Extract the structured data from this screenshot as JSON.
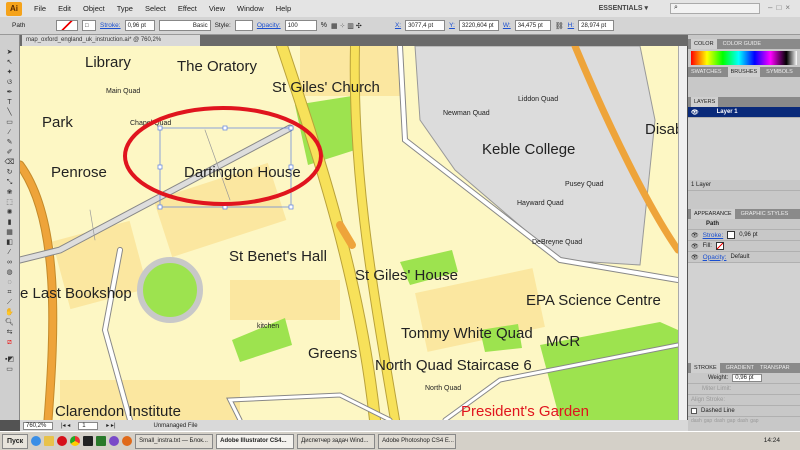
{
  "app": {
    "logo": "Ai",
    "menus": [
      "File",
      "Edit",
      "Object",
      "Type",
      "Select",
      "Effect",
      "View",
      "Window",
      "Help"
    ],
    "workspace": "ESSENTIALS ▾"
  },
  "control": {
    "selection": "Path",
    "stroke_label": "Stroke:",
    "stroke_value": "0,96 pt",
    "brush": "Basic",
    "style_label": "Style:",
    "opacity_label": "Opacity:",
    "opacity_value": "100",
    "opacity_unit": "%",
    "x_label": "X:",
    "x_value": "3077,4 pt",
    "y_label": "Y:",
    "y_value": "3220,604 pt",
    "w_label": "W:",
    "w_value": "34,475 pt",
    "h_label": "H:",
    "h_value": "28,974 pt"
  },
  "document": {
    "tab": "map_oxford_england_uk_instruction.ai* @ 760,2% (RGB/Preview)",
    "zoom": "760,2%",
    "page": "1",
    "status": "Unmanaged File"
  },
  "map": {
    "labels_large": [
      "Library",
      "The Oratory",
      "St Giles' Church",
      "Park",
      "Dartington House",
      "Penrose",
      "Keble College",
      "Disab",
      "St Benet's Hall",
      "St Giles' House",
      "e Last Bookshop",
      "EPA Science Centre",
      "Tommy White Quad",
      "MCR",
      "Greens",
      "North Quad Staircase 6",
      "Clarendon Institute"
    ],
    "labels_small": [
      "Main Quad",
      "Chapel Quad",
      "Newman Quad",
      "Liddon Quad",
      "Pusey Quad",
      "Hayward Quad",
      "DeBreyne Quad",
      "kitchen",
      "North Quad"
    ],
    "highlight_label": "President's Garden",
    "colors": {
      "background": "#fdf7c4",
      "building": "#fbe7a0",
      "park": "#9de34f",
      "major_road": "#f7e15a",
      "orange_road": "#eea43a",
      "college": "#dcdcdc",
      "annotation": "#e0141e",
      "highlight": "#e0141e"
    }
  },
  "panels": {
    "color": {
      "tabs": [
        "COLOR",
        "COLOR GUIDE"
      ]
    },
    "swatches": {
      "tabs": [
        "SWATCHES",
        "BRUSHES",
        "SYMBOLS"
      ]
    },
    "layers": {
      "tab": "LAYERS",
      "layer": "Layer 1",
      "count": "1 Layer"
    },
    "appearance": {
      "tabs": [
        "APPEARANCE",
        "GRAPHIC STYLES"
      ],
      "object": "Path",
      "stroke_label": "Stroke:",
      "stroke_value": "0,96 pt",
      "fill_label": "Fill:",
      "opacity_label": "Opacity:",
      "opacity_value": "Default"
    },
    "stroke": {
      "tabs": [
        "STROKE",
        "GRADIENT",
        "TRANSPAR"
      ],
      "weight_label": "Weight:",
      "weight_value": "0,96 pt",
      "miter_label": "Miter Limit:",
      "align_label": "Align Stroke:",
      "dashed_label": "Dashed Line",
      "dash_labels": [
        "dash",
        "gap",
        "dash",
        "gap",
        "dash",
        "gap"
      ]
    }
  },
  "taskbar": {
    "start": "Пуск",
    "tasks": [
      "Small_instra.txt — Блок...",
      "Adobe Illustrator CS4...",
      "Диспетчер задач Wind...",
      "Adobe Photoshop CS4 E..."
    ],
    "active": 1,
    "clock": "14:24"
  }
}
